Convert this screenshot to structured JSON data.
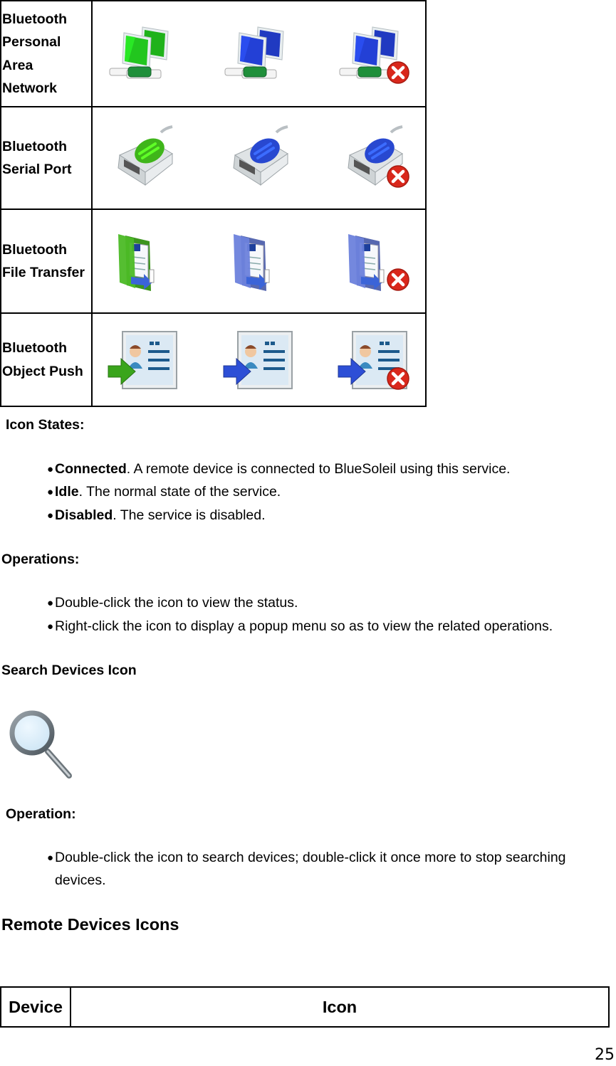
{
  "services": [
    {
      "label_lines": [
        "Bluetooth",
        "Personal",
        "Area",
        "Network"
      ],
      "icon": "network-computers",
      "states": [
        "connected",
        "idle",
        "disabled"
      ]
    },
    {
      "label_lines": [
        "Bluetooth",
        "Serial Port"
      ],
      "icon": "serial-port",
      "states": [
        "connected",
        "idle",
        "disabled"
      ]
    },
    {
      "label_lines": [
        "Bluetooth",
        "File Transfer"
      ],
      "icon": "file-transfer-folder",
      "states": [
        "connected",
        "idle",
        "disabled"
      ]
    },
    {
      "label_lines": [
        "Bluetooth",
        "Object Push"
      ],
      "icon": "object-push-card",
      "states": [
        "connected",
        "idle",
        "disabled"
      ]
    }
  ],
  "icon_states": {
    "heading": "Icon States:",
    "items": [
      {
        "term": "Connected",
        "desc": ". A remote device is connected to BlueSoleil using this service."
      },
      {
        "term": "Idle",
        "desc": ". The normal state of the service."
      },
      {
        "term": "Disabled",
        "desc": ". The service is disabled."
      }
    ]
  },
  "operations": {
    "heading": "Operations:",
    "items": [
      "Double-click the icon to view the status.",
      "Right-click the icon to display a popup menu so as to view the related operations."
    ]
  },
  "search_devices": {
    "heading": "Search Devices Icon",
    "icon": "magnifier",
    "operation_heading": "Operation:",
    "operation_lines": [
      "Double-click the icon to search devices; double-click it once more to stop searching",
      "devices."
    ]
  },
  "remote_devices": {
    "heading": "Remote Devices Icons",
    "table_headers": [
      "Device",
      "Icon"
    ]
  },
  "colors": {
    "connected": "#2fc42a",
    "idle": "#2f4fd8",
    "disabled_badge": "#d9281c"
  },
  "page_number": "25"
}
